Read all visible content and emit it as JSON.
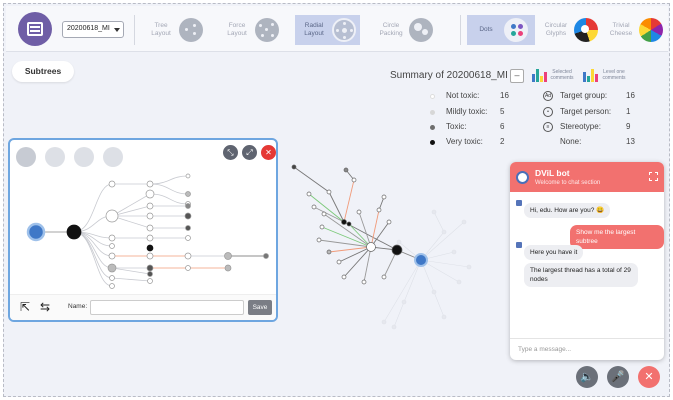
{
  "toolbar": {
    "dataset": "20200618_MI",
    "layouts": [
      {
        "label": "Tree Layout",
        "icon": "tree-layout-icon",
        "active": false
      },
      {
        "label": "Force Layout",
        "icon": "force-layout-icon",
        "active": false
      },
      {
        "label": "Radial Layout",
        "icon": "radial-layout-icon",
        "active": true
      },
      {
        "label": "Circle Packing",
        "icon": "circle-packing-icon",
        "active": false
      }
    ],
    "glyphs": [
      {
        "label": "Dots",
        "icon": "dots-glyph-icon",
        "active": true
      },
      {
        "label": "Circular Glyphs",
        "icon": "circular-glyphs-icon",
        "active": false
      },
      {
        "label": "Trivial Cheese",
        "icon": "trivial-cheese-icon",
        "active": false
      }
    ]
  },
  "subtrees_label": "Subtrees",
  "summary": {
    "title": "Summary of 20200618_MI",
    "collapse": "–",
    "selected_comments": "Selected comments",
    "level_one_comments": "Level one comments",
    "toxicity": [
      {
        "label": "Not toxic:",
        "value": "16",
        "color": "#ffffff"
      },
      {
        "label": "Mildly toxic:",
        "value": "5",
        "color": "#d7d7d7"
      },
      {
        "label": "Toxic:",
        "value": "6",
        "color": "#6e6e6e"
      },
      {
        "label": "Very toxic:",
        "value": "2",
        "color": "#111111"
      }
    ],
    "targets": [
      {
        "label": "Target group:",
        "value": "16",
        "icon": "target-group-icon",
        "glyph": "Ad"
      },
      {
        "label": "Target person:",
        "value": "1",
        "icon": "target-person-icon",
        "glyph": "•"
      },
      {
        "label": "Stereotype:",
        "value": "9",
        "icon": "stereotype-icon",
        "glyph": "≡"
      },
      {
        "label": "None:",
        "value": "13",
        "icon": "none-icon",
        "glyph": ""
      }
    ]
  },
  "panel": {
    "name_label": "Name:",
    "name_value": "",
    "save_label": "Save"
  },
  "chat": {
    "title": "DViL bot",
    "subtitle": "Welcome to chat section",
    "messages": [
      {
        "from": "bot",
        "text": "Hi, edu. How are you? 😀"
      },
      {
        "from": "user",
        "text": "Show me the largest subtree"
      },
      {
        "from": "bot",
        "text": "Here you have it"
      },
      {
        "from": "bot",
        "text": "The largest thread has a total of 29 nodes"
      }
    ],
    "input_placeholder": "Type a message..."
  },
  "colors": {
    "accent": "#f2716f",
    "active_tab": "#c8d1ec",
    "panel_border": "#6ea6e0",
    "root_node": "#3f78c7"
  }
}
